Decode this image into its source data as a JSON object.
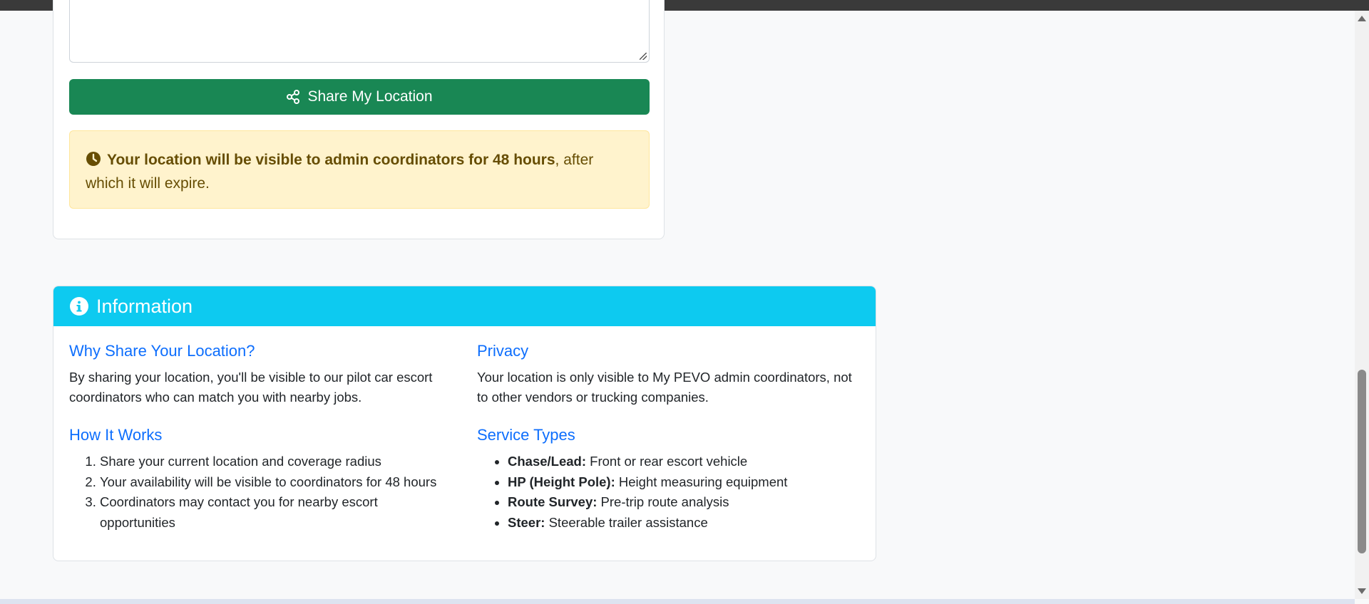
{
  "share_button": {
    "label": "Share My Location",
    "color": "#198754"
  },
  "alert": {
    "bold_text": "Your location will be visible to admin coordinators for 48 hours",
    "rest_text": ", after which it will expire.",
    "icon": "clock-icon"
  },
  "info": {
    "title": "Information",
    "icon": "info-circle-icon",
    "header_color": "#0dcaf0",
    "why": {
      "heading": "Why Share Your Location?",
      "text": "By sharing your location, you'll be visible to our pilot car escort coordinators who can match you with nearby jobs."
    },
    "how": {
      "heading": "How It Works",
      "steps": [
        "Share your current location and coverage radius",
        "Your availability will be visible to coordinators for 48 hours",
        "Coordinators may contact you for nearby escort opportunities"
      ]
    },
    "privacy": {
      "heading": "Privacy",
      "text": "Your location is only visible to My PEVO admin coordinators, not to other vendors or trucking companies."
    },
    "service_types": {
      "heading": "Service Types",
      "items": [
        {
          "label": "Chase/Lead:",
          "desc": " Front or rear escort vehicle"
        },
        {
          "label": "HP (Height Pole):",
          "desc": " Height measuring equipment"
        },
        {
          "label": "Route Survey:",
          "desc": " Pre-trip route analysis"
        },
        {
          "label": "Steer:",
          "desc": " Steerable trailer assistance"
        }
      ]
    }
  }
}
